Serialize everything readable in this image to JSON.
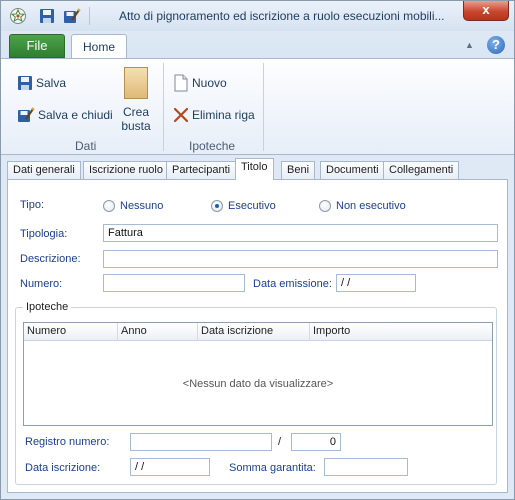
{
  "window": {
    "title": "Atto di pignoramento ed iscrizione a ruolo esecuzioni mobili...",
    "close_label": "x"
  },
  "ribbon": {
    "file_tab": "File",
    "home_tab": "Home",
    "buttons": {
      "salva": "Salva",
      "salva_chiudi": "Salva e chiudi",
      "crea_busta_1": "Crea",
      "crea_busta_2": "busta",
      "nuovo": "Nuovo",
      "elimina_riga": "Elimina riga"
    },
    "groups": {
      "dati": "Dati",
      "ipoteche": "Ipoteche"
    },
    "help": "?"
  },
  "tabs": [
    "Dati generali",
    "Iscrizione ruolo",
    "Partecipanti",
    "Titolo",
    "Beni",
    "Documenti",
    "Collegamenti"
  ],
  "active_tab": "Titolo",
  "form": {
    "tipo_label": "Tipo:",
    "tipo_options": [
      "Nessuno",
      "Esecutivo",
      "Non esecutivo"
    ],
    "tipo_selected": "Esecutivo",
    "tipologia_label": "Tipologia:",
    "tipologia_value": "Fattura",
    "descrizione_label": "Descrizione:",
    "descrizione_value": "",
    "numero_label": "Numero:",
    "numero_value": "",
    "data_emissione_label": "Data emissione:",
    "data_emissione_value": "/ /"
  },
  "ipoteche": {
    "title": "Ipoteche",
    "columns": [
      "Numero",
      "Anno",
      "Data iscrizione",
      "Importo"
    ],
    "empty_text": "<Nessun dato da visualizzare>",
    "registro_numero_label": "Registro numero:",
    "registro_numero_value": "",
    "slash": "/",
    "registro_anno_value": "0",
    "data_iscrizione_label": "Data iscrizione:",
    "data_iscrizione_value": "/ /",
    "somma_garantita_label": "Somma garantita:",
    "somma_garantita_value": ""
  },
  "colors": {
    "accent": "#1b3f8f",
    "file_tab": "#3a8a36",
    "close_button": "#c8472f"
  }
}
